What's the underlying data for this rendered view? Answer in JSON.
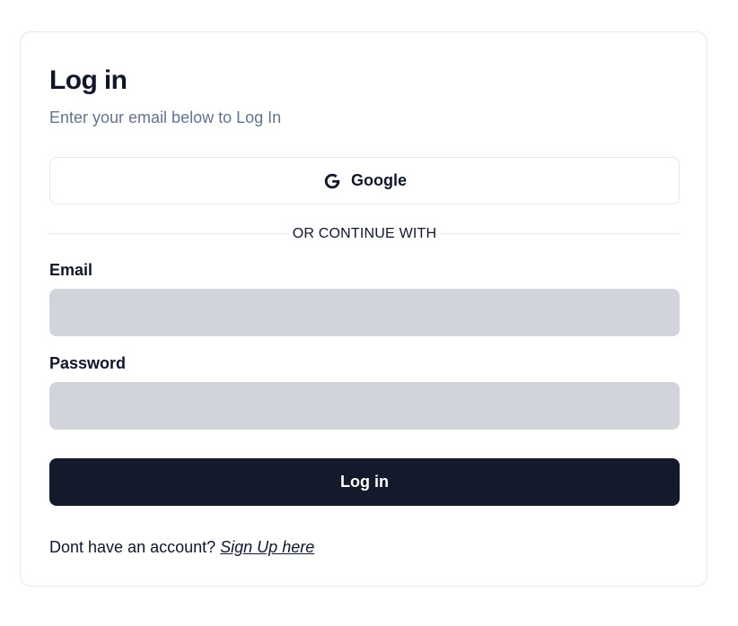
{
  "login_card": {
    "title": "Log in",
    "subtitle": "Enter your email below to Log In",
    "google_button": {
      "label": "Google",
      "icon": "google-g-icon"
    },
    "divider_text": "OR CONTINUE WITH",
    "email": {
      "label": "Email",
      "value": "",
      "placeholder": ""
    },
    "password": {
      "label": "Password",
      "value": "",
      "placeholder": ""
    },
    "submit_label": "Log in",
    "footer": {
      "prompt": "Dont have an account?",
      "link_label": "Sign Up here"
    }
  },
  "colors": {
    "primary_button": "#141a2b",
    "input_background": "#d1d5db",
    "muted_text": "#64748b",
    "border": "#e2e8f0"
  }
}
